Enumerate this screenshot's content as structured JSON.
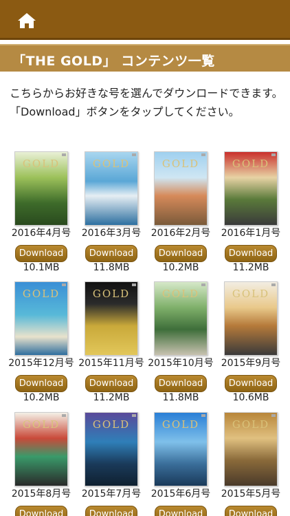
{
  "header": {
    "home_icon": "home-icon"
  },
  "title": "「THE GOLD」 コンテンツ一覧",
  "intro": {
    "line1": "こちらからお好きな号を選んでダウンロードできます。",
    "line2": "「Download」ボタンをタップしてください。"
  },
  "download_label": "Download",
  "issues": [
    {
      "label": "2016年4月号",
      "size": "10.1MB"
    },
    {
      "label": "2016年3月号",
      "size": "11.8MB"
    },
    {
      "label": "2016年2月号",
      "size": "10.2MB"
    },
    {
      "label": "2016年1月号",
      "size": "11.2MB"
    },
    {
      "label": "2015年12月号",
      "size": "10.2MB"
    },
    {
      "label": "2015年11月号",
      "size": "11.2MB"
    },
    {
      "label": "2015年10月号",
      "size": "11.8MB"
    },
    {
      "label": "2015年9月号",
      "size": "10.6MB"
    },
    {
      "label": "2015年8月号",
      "size": ""
    },
    {
      "label": "2015年7月号",
      "size": ""
    },
    {
      "label": "2015年6月号",
      "size": ""
    },
    {
      "label": "2015年5月号",
      "size": ""
    }
  ],
  "cover_masthead": "GOLD",
  "colors": {
    "topbar": "#8b5a12",
    "band": "#b58a43",
    "button": "#a67a25"
  }
}
